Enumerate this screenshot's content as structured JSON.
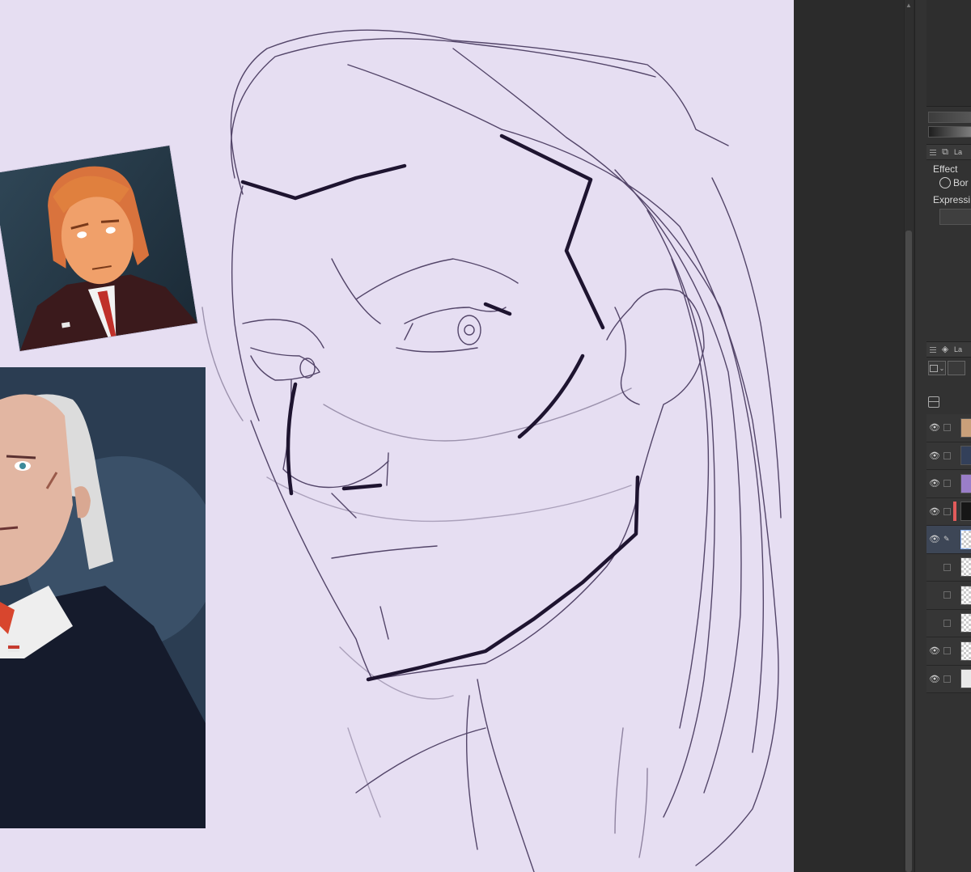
{
  "panel": {
    "effect_label": "Effect",
    "border_option_label": "Bor",
    "expression_label": "Expressi",
    "layer_tab_top_label": "La",
    "layer_tab_label": "La"
  },
  "layers": [
    {
      "visible": true,
      "thumb": "#c9a07a",
      "swatch": "",
      "active": false
    },
    {
      "visible": true,
      "thumb": "#33405a",
      "swatch": "",
      "active": false
    },
    {
      "visible": true,
      "thumb": "#9a7ec8",
      "swatch": "",
      "active": false
    },
    {
      "visible": true,
      "thumb": "#161616",
      "swatch": "#e25b5b",
      "active": false
    },
    {
      "visible": true,
      "thumb": "checker",
      "swatch": "",
      "active": true
    },
    {
      "visible": false,
      "thumb": "checker",
      "swatch": "",
      "active": false
    },
    {
      "visible": false,
      "thumb": "checker",
      "swatch": "",
      "active": false
    },
    {
      "visible": false,
      "thumb": "checker",
      "swatch": "",
      "active": false
    },
    {
      "visible": true,
      "thumb": "checker",
      "swatch": "",
      "active": false
    },
    {
      "visible": true,
      "thumb": "#e9e9e9",
      "swatch": "",
      "active": false
    }
  ],
  "colors": {
    "canvas_bg": "#e6def2",
    "sketch_stroke": "#3a2b52",
    "panel_bg": "#323232"
  }
}
